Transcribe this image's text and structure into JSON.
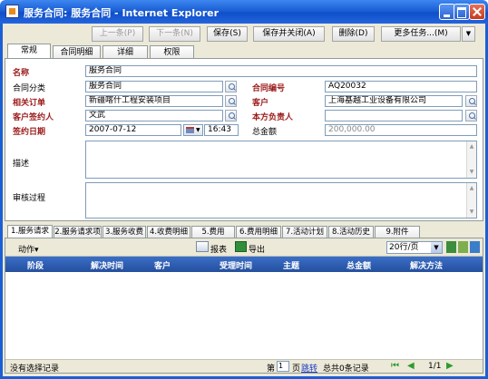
{
  "window": {
    "title": "服务合同: 服务合同 - Internet Explorer"
  },
  "toolbar": {
    "prev_label": "上一条(P)",
    "next_label": "下一条(N)",
    "save_label": "保存(S)",
    "save_close_label": "保存并关闭(A)",
    "delete_label": "删除(D)",
    "more_label": "更多任务...(M)"
  },
  "tabs": [
    {
      "label": "常规"
    },
    {
      "label": "合同明细"
    },
    {
      "label": "详细"
    },
    {
      "label": "权限"
    }
  ],
  "form": {
    "name_label": "名称",
    "name_value": "服务合同",
    "category_label": "合同分类",
    "category_value": "服务合同",
    "contract_no_label": "合同编号",
    "contract_no_value": "AQ20032",
    "order_label": "相关订单",
    "order_value": "新疆喀什工程安装项目",
    "customer_label": "客户",
    "customer_value": "上海基越工业设备有限公司",
    "signer_label": "客户签约人",
    "signer_value": "文武",
    "owner_label": "本方负责人",
    "owner_value": "",
    "date_label": "签约日期",
    "date_value": "2007-07-12",
    "time_value": "16:43",
    "amount_label": "总金额",
    "amount_value": "200,000.00",
    "desc_label": "描述",
    "review_label": "审核过程"
  },
  "bottom_tabs": [
    {
      "label": "1.服务请求"
    },
    {
      "label": "2.服务请求项"
    },
    {
      "label": "3.服务收费"
    },
    {
      "label": "4.收费明细"
    },
    {
      "label": "5.费用"
    },
    {
      "label": "6.费用明细"
    },
    {
      "label": "7.活动计划"
    },
    {
      "label": "8.活动历史"
    },
    {
      "label": "9.附件"
    }
  ],
  "grid": {
    "action_label": "动作▾",
    "report_label": "报表",
    "export_label": "导出",
    "page_size": "20行/页",
    "columns": [
      "阶段",
      "解决时间",
      "客户",
      "受理时间",
      "主题",
      "总金额",
      "解决方法"
    ]
  },
  "status": {
    "left_text": "没有选择记录",
    "page_prefix": "第",
    "page_value": "1",
    "page_suffix": "页",
    "jump_label": "跳转",
    "total_text": "总共0条记录",
    "page_info": "1/1"
  },
  "colors": {
    "title_blue": "#1b5fd6",
    "required_red": "#9b1a1a",
    "grid_header": "#244f9e"
  }
}
